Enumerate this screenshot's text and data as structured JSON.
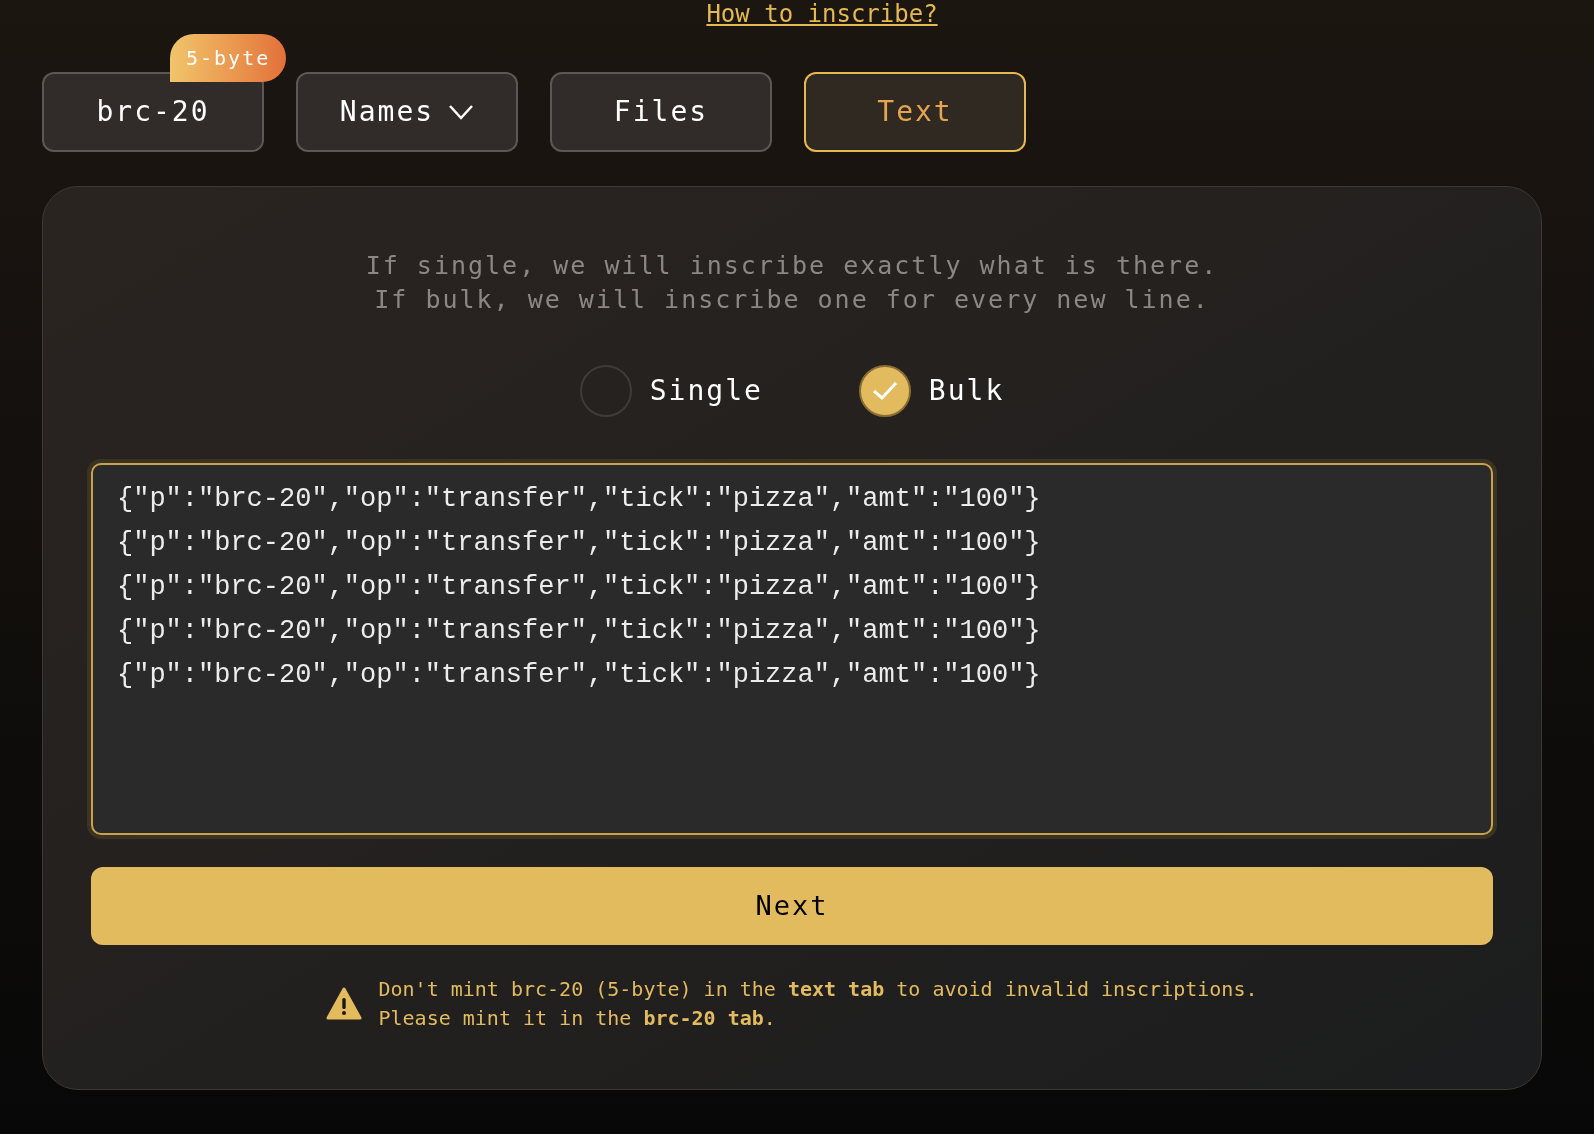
{
  "help_link": "How to inscribe?",
  "tabs": [
    {
      "label": "brc-20",
      "kind": "plain",
      "badge": "5-byte",
      "selected": false
    },
    {
      "label": "Names",
      "kind": "dropdown",
      "selected": false
    },
    {
      "label": "Files",
      "kind": "plain",
      "selected": false
    },
    {
      "label": "Text",
      "kind": "plain",
      "selected": true
    }
  ],
  "description": [
    "If single, we will inscribe exactly what is there.",
    "If bulk, we will inscribe one for every new line."
  ],
  "modes": [
    {
      "label": "Single",
      "selected": false
    },
    {
      "label": "Bulk",
      "selected": true
    }
  ],
  "editor": {
    "lines": [
      "{\"p\":\"brc-20\",\"op\":\"transfer\",\"tick\":\"pizza\",\"amt\":\"100\"}",
      "{\"p\":\"brc-20\",\"op\":\"transfer\",\"tick\":\"pizza\",\"amt\":\"100\"}",
      "{\"p\":\"brc-20\",\"op\":\"transfer\",\"tick\":\"pizza\",\"amt\":\"100\"}",
      "{\"p\":\"brc-20\",\"op\":\"transfer\",\"tick\":\"pizza\",\"amt\":\"100\"}",
      "{\"p\":\"brc-20\",\"op\":\"transfer\",\"tick\":\"pizza\",\"amt\":\"100\"}"
    ]
  },
  "next_button": "Next",
  "warning": [
    "Don't mint brc-20 (5-byte) in the **text tab** to avoid invalid inscriptions.",
    "Please mint it in the **brc-20 tab**."
  ]
}
